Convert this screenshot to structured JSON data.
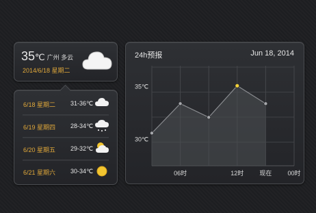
{
  "current": {
    "temp": "35",
    "unit": "℃",
    "city_weather": "广州 多云",
    "date": "2014/6/18 星期二",
    "icon": "cloud-icon"
  },
  "forecast": [
    {
      "day": "6/18 星期二",
      "range": "31-36℃",
      "icon": "cloud-icon"
    },
    {
      "day": "6/19 星期四",
      "range": "28-34℃",
      "icon": "rain-cloud-icon"
    },
    {
      "day": "6/20 星期五",
      "range": "29-32℃",
      "icon": "partly-cloudy-icon"
    },
    {
      "day": "6/21 星期六",
      "range": "30-34℃",
      "icon": "sun-icon"
    }
  ],
  "chart": {
    "title": "24h预报",
    "date": "Jun 18, 2014"
  },
  "chart_data": {
    "type": "area",
    "x": [
      "",
      "06时",
      "",
      "12时",
      "现在",
      "00时"
    ],
    "y_ticks": [
      "35℃",
      "30℃"
    ],
    "values": [
      30.6,
      33.4,
      32.1,
      35.1,
      33.4
    ],
    "x_positions": [
      0,
      1,
      2,
      3,
      4
    ],
    "point_labels": [
      "",
      "06时",
      "",
      "现在",
      "00时"
    ],
    "highlight_index": 3,
    "ylim": [
      27.5,
      37
    ],
    "grid": true,
    "colors": {
      "line": "#8a8c90",
      "point": "#a6a8ac",
      "highlight": "#f2d13a",
      "area": "#4a4c50"
    }
  }
}
